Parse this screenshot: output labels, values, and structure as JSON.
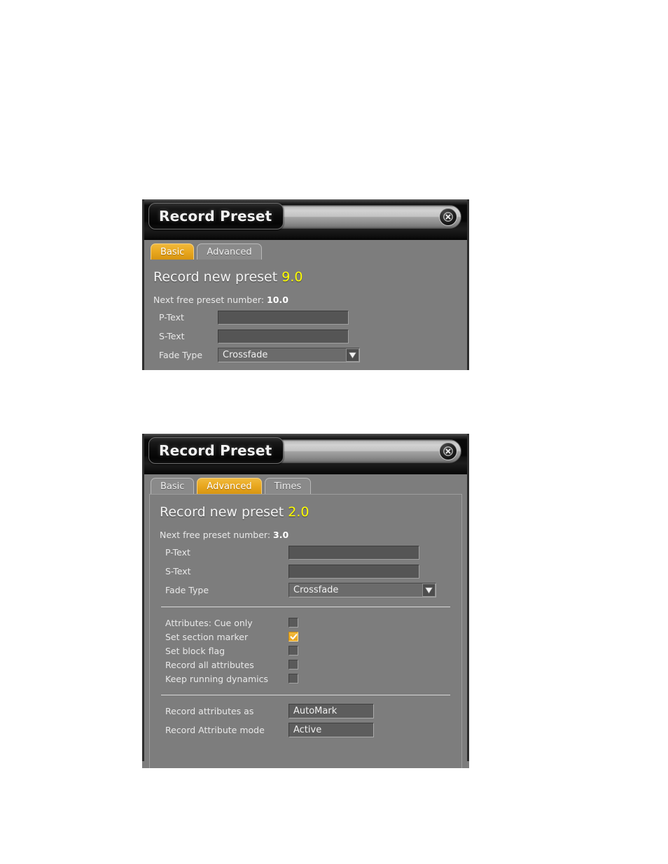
{
  "page": {
    "background_color": "#ffffff",
    "dialog_background": "#7d7d7d",
    "accent_color": "#e9a81f",
    "highlight_number_color": "#ffff00"
  },
  "dialogs": [
    {
      "id": "record-preset-basic",
      "title": "Record Preset",
      "close_icon": "close-circle-icon",
      "tabs": [
        {
          "label": "Basic",
          "active": true
        },
        {
          "label": "Advanced",
          "active": false
        }
      ],
      "heading": {
        "text": "Record new preset",
        "number": "9.0"
      },
      "next_free": {
        "label": "Next free preset number:",
        "value": "10.0"
      },
      "fields": [
        {
          "label": "P-Text",
          "value": "",
          "placeholder": ""
        },
        {
          "label": "S-Text",
          "value": "",
          "placeholder": ""
        }
      ],
      "fade_type": {
        "label": "Fade Type",
        "value": "Crossfade",
        "arrow_icon": "chevron-down-icon"
      }
    },
    {
      "id": "record-preset-advanced",
      "title": "Record Preset",
      "close_icon": "close-circle-icon",
      "tabs": [
        {
          "label": "Basic",
          "active": false
        },
        {
          "label": "Advanced",
          "active": true
        },
        {
          "label": "Times",
          "active": false
        }
      ],
      "heading": {
        "text": "Record new preset",
        "number": "2.0"
      },
      "next_free": {
        "label": "Next free preset number:",
        "value": "3.0"
      },
      "fields": [
        {
          "label": "P-Text",
          "value": "",
          "placeholder": ""
        },
        {
          "label": "S-Text",
          "value": "",
          "placeholder": ""
        }
      ],
      "fade_type": {
        "label": "Fade Type",
        "value": "Crossfade",
        "arrow_icon": "chevron-down-icon"
      },
      "checkboxes": [
        {
          "label": "Attributes: Cue only",
          "checked": false
        },
        {
          "label": "Set section marker",
          "checked": true
        },
        {
          "label": "Set block flag",
          "checked": false
        },
        {
          "label": "Record all attributes",
          "checked": false
        },
        {
          "label": "Keep running dynamics",
          "checked": false
        }
      ],
      "selectors": [
        {
          "label": "Record attributes as",
          "value": "AutoMark"
        },
        {
          "label": "Record Attribute mode",
          "value": "Active"
        }
      ]
    }
  ]
}
